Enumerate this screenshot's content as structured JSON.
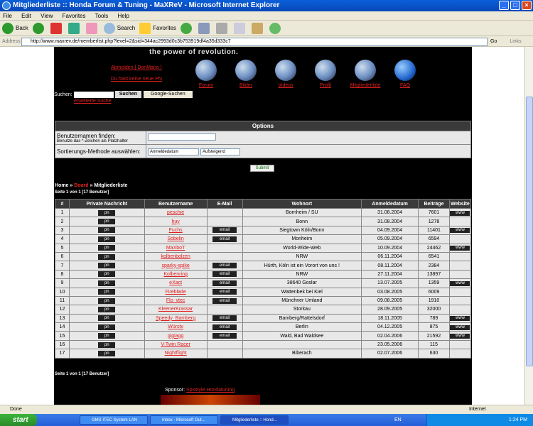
{
  "window": {
    "title": "Mitgliederliste :: Honda Forum & Tuning - MaXReV - Microsoft Internet Explorer"
  },
  "menu": [
    "File",
    "Edit",
    "View",
    "Favorites",
    "Tools",
    "Help"
  ],
  "toolbar": {
    "back": "Back",
    "search": "Search",
    "favorites": "Favorites"
  },
  "address": {
    "label": "Address",
    "url": "http://www.maxrev.de/memberlist.php?level=2&sid=344ac2993d0c3b753919df4a35d333c7",
    "go": "Go",
    "links": "Links"
  },
  "site": {
    "slogan": "the power of revolution.",
    "logout": "Abmelden [ DonMano ]",
    "pm": "Du hast keine neue PN",
    "nav": [
      "Forum",
      "Bilder",
      "Videos",
      "Profil",
      "Mitgliederliste",
      "FAQ"
    ],
    "search_label": "Suchen:",
    "search_btn": "Suchen",
    "google_btn": "Google-Suchen",
    "extended": "erweiterte Suche"
  },
  "options": {
    "header": "Options",
    "find_label": "Benutzernamen finden:",
    "find_hint": "Benutze das *-Zeichen als Platzhalter",
    "sort_label": "Sortierungs-Methode auswählen:",
    "sort_value": "Anmeldedatum",
    "order_value": "Aufsteigend",
    "submit": "Submit"
  },
  "breadcrumb": {
    "home": "Home",
    "board": "Board",
    "current": "Mitgliederliste",
    "sep": "»"
  },
  "page_info": "Seite 1 von 1",
  "member_count": "[17 Benutzer]",
  "columns": [
    "#",
    "Private Nachricht",
    "Benutzername",
    "E-Mail",
    "Wohnort",
    "Anmeldedatum",
    "Beiträge",
    "Website"
  ],
  "members": [
    {
      "n": "1",
      "name": "peschie",
      "email": false,
      "city": "Bornheim / SU",
      "date": "31.08.2004",
      "posts": "7601",
      "www": true
    },
    {
      "n": "2",
      "name": "huy",
      "email": false,
      "city": "Bonn",
      "date": "31.08.2004",
      "posts": "1278",
      "www": false
    },
    {
      "n": "3",
      "name": "Fuchs",
      "email": true,
      "city": "Siegtown Köln/Bonn",
      "date": "04.09.2004",
      "posts": "11401",
      "www": true
    },
    {
      "n": "4",
      "name": "Sobelin",
      "email": true,
      "city": "Monheim",
      "date": "05.09.2004",
      "posts": "6594",
      "www": false
    },
    {
      "n": "5",
      "name": "MaXboT",
      "email": false,
      "city": "World-Wide-Web",
      "date": "10.09.2004",
      "posts": "24462",
      "www": true
    },
    {
      "n": "6",
      "name": "kolbenbolzen",
      "email": false,
      "city": "NRW",
      "date": "06.11.2004",
      "posts": "6541",
      "www": false
    },
    {
      "n": "7",
      "name": "sparky-spike",
      "email": true,
      "city": "Hürth, Köln ist ein Vorort von uns !",
      "date": "08.11.2004",
      "posts": "2384",
      "www": false
    },
    {
      "n": "8",
      "name": "Kolbenring",
      "email": true,
      "city": "NRW",
      "date": "27.11.2004",
      "posts": "13897",
      "www": false
    },
    {
      "n": "9",
      "name": "eXact",
      "email": true,
      "city": "38640 Goslar",
      "date": "13.07.2005",
      "posts": "1359",
      "www": true
    },
    {
      "n": "10",
      "name": "Fireblade",
      "email": true,
      "city": "Wattenbek bei Kiel",
      "date": "03.08.2005",
      "posts": "6009",
      "www": false
    },
    {
      "n": "11",
      "name": "Flo_vtec",
      "email": true,
      "city": "Münchner Umland",
      "date": "09.08.2005",
      "posts": "1910",
      "www": false
    },
    {
      "n": "12",
      "name": "KleenerKrassar",
      "email": false,
      "city": "Storkau",
      "date": "28.09.2005",
      "posts": "32000",
      "www": false
    },
    {
      "n": "13",
      "name": "Speedy_Bamberg",
      "email": true,
      "city": "Bamberg/Rattelsdorf",
      "date": "18.11.2005",
      "posts": "789",
      "www": true
    },
    {
      "n": "14",
      "name": "Würstv",
      "email": true,
      "city": "Berlin",
      "date": "04.12.2005",
      "posts": "875",
      "www": true
    },
    {
      "n": "15",
      "name": "gigiagg",
      "email": true,
      "city": "Wald, Bad Waldsee",
      "date": "02.04.2006",
      "posts": "21592",
      "www": true
    },
    {
      "n": "16",
      "name": "V-Twin Racer",
      "email": false,
      "city": "",
      "date": "23.05.2006",
      "posts": "115",
      "www": false
    },
    {
      "n": "17",
      "name": "Nightflight",
      "email": false,
      "city": "Biberach",
      "date": "02.07.2006",
      "posts": "630",
      "www": false
    }
  ],
  "buttons": {
    "pm": "pn",
    "email": "email",
    "www": "www"
  },
  "sponsor": {
    "label": "Sponsor:",
    "name": "Spxstyle Hondatuning"
  },
  "status": {
    "left": "Done",
    "zone": "Internet"
  },
  "taskbar": {
    "start": "start",
    "tasks": [
      "GMS ITEC System LAN",
      "Inbox - Microsoft Out...",
      "Mitgliederliste :: Hond..."
    ],
    "lang": "EN",
    "clock": "1:24 PM"
  }
}
